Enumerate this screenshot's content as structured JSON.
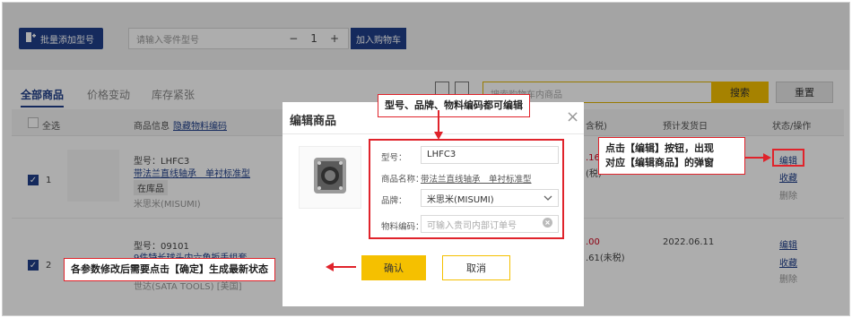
{
  "toolbar": {
    "batch_add_label": "批量添加型号",
    "part_input_placeholder": "请输入零件型号",
    "minus": "−",
    "qty": "1",
    "plus": "+",
    "add_to_cart_label": "加入购物车"
  },
  "tabs": [
    "全部商品",
    "价格变动",
    "库存紧张"
  ],
  "search": {
    "placeholder": "搜索购物车内商品",
    "button": "搜索",
    "reset": "重置"
  },
  "table_header": {
    "select_all": "全选",
    "product_info": "商品信息",
    "hide_code": "隐藏物料编码",
    "price_partial": "含税)",
    "ship_date": "预计发货日",
    "status_ops": "状态/操作"
  },
  "rows": [
    {
      "index": "1",
      "model": "型号：LHFC3",
      "name": "带法兰直线轴承　单衬标准型",
      "stock": "在库品",
      "brand": "米思米(MISUMI)",
      "price_partial": ".16",
      "price_partial2": "(税)",
      "ops": [
        "编辑",
        "收藏",
        "删除"
      ]
    },
    {
      "index": "2",
      "model": "型号：09101",
      "name": "9件特长球头内六角扳手组套",
      "brand": "世达(SATA TOOLS) [美国]",
      "price_partial": ".00",
      "price_partial2": ".61(未税)",
      "ship_date": "2022.06.11",
      "ops": [
        "编辑",
        "收藏",
        "删除"
      ]
    }
  ],
  "modal": {
    "title": "编辑商品",
    "close": "×",
    "model_label": "型号：",
    "model_value": "LHFC3",
    "name_label": "商品名称：",
    "name_value": "带法兰直线轴承　单衬标准型",
    "brand_label": "品牌：",
    "brand_value": "米思米(MISUMI)",
    "code_label": "物料编码：",
    "code_placeholder": "可输入贵司内部订单号",
    "confirm": "确认",
    "cancel": "取消"
  },
  "callouts": {
    "top": "型号、品牌、物料编码都可编辑",
    "right_line1": "点击【编辑】按钮，出现",
    "right_line2": "对应【编辑商品】的弹窗",
    "left": "各参数修改后需要点击【确定】生成最新状态"
  },
  "colors": {
    "primary": "#1f3f8a",
    "accent": "#f5c000",
    "annotation": "#e0232b"
  }
}
